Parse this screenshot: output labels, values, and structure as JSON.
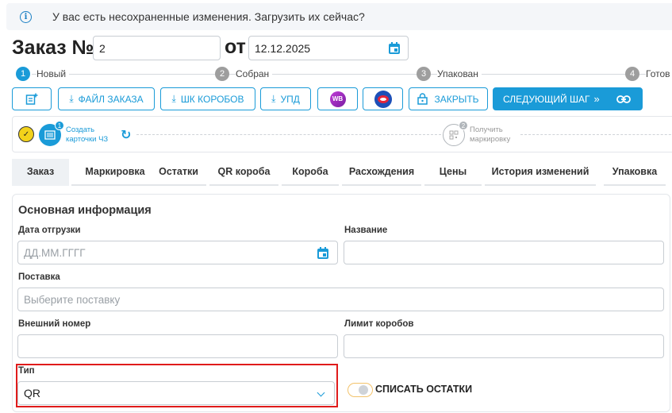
{
  "notice": {
    "text": "У вас есть несохраненные изменения. Загрузить их сейчас?",
    "icon": "info-icon"
  },
  "header": {
    "title": "Заказ №",
    "order_number": "2",
    "date_sep": "от",
    "date": "12.12.2025"
  },
  "steps": [
    {
      "num": "1",
      "label": "Новый",
      "active": true
    },
    {
      "num": "2",
      "label": "Собран",
      "active": false
    },
    {
      "num": "3",
      "label": "Упакован",
      "active": false
    },
    {
      "num": "4",
      "label": "Готов к",
      "active": false
    }
  ],
  "toolbar": {
    "order_file": "ФАЙЛ ЗАКАЗА",
    "box_barcodes": "ШК КОРОБОВ",
    "upd": "УПД",
    "wb": "WB",
    "close": "ЗАКРЫТЬ",
    "next_step": "СЛЕДУЮЩИЙ ШАГ",
    "next_arrow": "»"
  },
  "progress": {
    "step1": {
      "num": "1",
      "label": "Создать карточки ЧЗ"
    },
    "step2": {
      "num": "2",
      "label": "Получить маркировку"
    }
  },
  "tabs": [
    "Заказ",
    "Маркировка",
    "Остатки",
    "QR короба",
    "Короба",
    "Расхождения",
    "Цены",
    "История изменений",
    "Упаковка"
  ],
  "form": {
    "title": "Основная информация",
    "ship_date_label": "Дата отгрузки",
    "ship_date_placeholder": "ДД.ММ.ГГГГ",
    "name_label": "Название",
    "supply_label": "Поставка",
    "supply_placeholder": "Выберите поставку",
    "ext_number_label": "Внешний номер",
    "box_limit_label": "Лимит коробов",
    "type_label": "Тип",
    "type_value": "QR",
    "writeoff_label": "СПИСАТЬ ОСТАТКИ"
  },
  "colors": {
    "accent": "#1a9bd8",
    "highlight": "#e01b1b",
    "toggle_border": "#f3c36b"
  }
}
